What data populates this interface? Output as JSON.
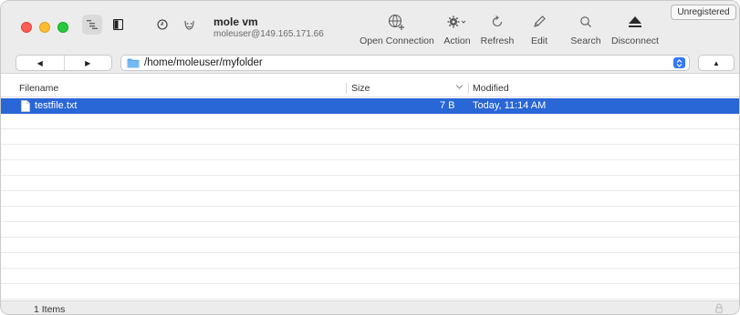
{
  "connection": {
    "name": "mole vm",
    "address": "moleuser@149.165.171.66"
  },
  "toolbar": {
    "tools": [
      {
        "label": "Open Connection",
        "icon": "globe-plus-icon"
      },
      {
        "label": "Action",
        "icon": "gear-dropdown-icon"
      },
      {
        "label": "Refresh",
        "icon": "refresh-icon"
      },
      {
        "label": "Edit",
        "icon": "pencil-icon"
      },
      {
        "label": "Search",
        "icon": "search-icon"
      },
      {
        "label": "Disconnect",
        "icon": "eject-icon"
      }
    ],
    "unregistered_label": "Unregistered"
  },
  "pathbar": {
    "path": "/home/moleuser/myfolder"
  },
  "table": {
    "columns": [
      "Filename",
      "Size",
      "Modified"
    ],
    "rows": [
      {
        "filename": "testfile.txt",
        "size": "7 B",
        "modified": "Today, 11:14 AM",
        "selected": true
      }
    ]
  },
  "status": {
    "count": "1 Items"
  },
  "colors": {
    "selection": "#2966d6",
    "folder": "#5aaaf0",
    "close": "#fe5f57",
    "minimize": "#febc2e",
    "zoom": "#28c840"
  }
}
